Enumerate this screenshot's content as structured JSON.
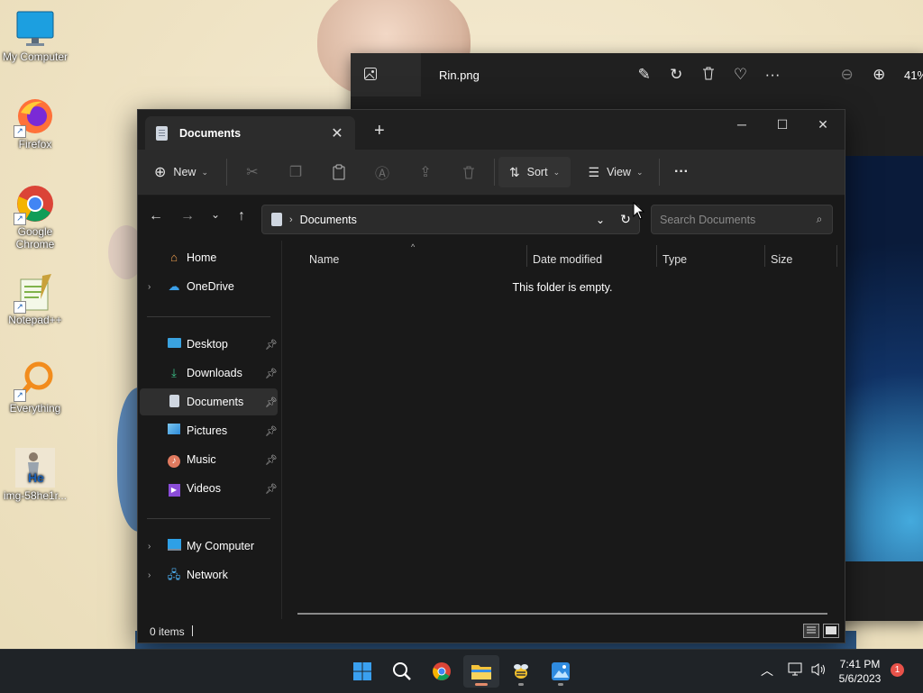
{
  "desktop": {
    "icons": [
      {
        "label": "My Computer",
        "icon": "monitor-icon"
      },
      {
        "label": "Firefox",
        "icon": "firefox-icon"
      },
      {
        "label": "Google Chrome",
        "icon": "chrome-icon"
      },
      {
        "label": "Notepad++",
        "icon": "notepadpp-icon"
      },
      {
        "label": "Everything",
        "icon": "everything-search-icon"
      },
      {
        "label": "img-58he1r...",
        "icon": "image-thumbnail-icon"
      }
    ]
  },
  "photos_window": {
    "tab_icon": "image-icon",
    "title": "Rin.png",
    "zoom": "41%",
    "tools": [
      "edit-icon",
      "rotate-icon",
      "delete-icon",
      "favorite-icon",
      "more-icon",
      "zoom-out-icon",
      "zoom-in-icon"
    ]
  },
  "explorer": {
    "tab": {
      "label": "Documents",
      "icon": "documents-icon"
    },
    "window_controls": {
      "minimize": "─",
      "maximize": "☐",
      "close": "✕"
    },
    "toolbar": {
      "new_label": "New",
      "sort_label": "Sort",
      "view_label": "View",
      "icons": [
        "cut-icon",
        "copy-icon",
        "paste-icon",
        "rename-icon",
        "share-icon",
        "delete-icon"
      ]
    },
    "address": {
      "path_label": "Documents",
      "search_placeholder": "Search Documents"
    },
    "nav_pane": {
      "top": [
        {
          "label": "Home",
          "icon": "home-icon",
          "expandable": false
        },
        {
          "label": "OneDrive",
          "icon": "onedrive-icon",
          "expandable": true
        }
      ],
      "quick_access": [
        {
          "label": "Desktop",
          "icon": "desktop-folder-icon",
          "pinned": true
        },
        {
          "label": "Downloads",
          "icon": "downloads-folder-icon",
          "pinned": true
        },
        {
          "label": "Documents",
          "icon": "documents-folder-icon",
          "pinned": true,
          "selected": true
        },
        {
          "label": "Pictures",
          "icon": "pictures-folder-icon",
          "pinned": true
        },
        {
          "label": "Music",
          "icon": "music-folder-icon",
          "pinned": true
        },
        {
          "label": "Videos",
          "icon": "videos-folder-icon",
          "pinned": true
        }
      ],
      "bottom": [
        {
          "label": "My Computer",
          "icon": "computer-icon",
          "expandable": true
        },
        {
          "label": "Network",
          "icon": "network-icon",
          "expandable": true
        }
      ]
    },
    "columns": [
      "Name",
      "Date modified",
      "Type",
      "Size"
    ],
    "empty_message": "This folder is empty.",
    "status": {
      "item_count": "0 items"
    }
  },
  "taskbar": {
    "apps": [
      "windows-start-icon",
      "search-icon",
      "chrome-icon",
      "file-explorer-icon",
      "bee-app-icon",
      "photos-app-icon"
    ],
    "tray": {
      "time": "7:41 PM",
      "date": "5/6/2023",
      "notifications": "1"
    }
  },
  "colors": {
    "explorer_bg": "#191919",
    "toolbar_bg": "#2b2b2b",
    "taskbar_bg": "#1f2327",
    "accent": "#0078d4"
  }
}
